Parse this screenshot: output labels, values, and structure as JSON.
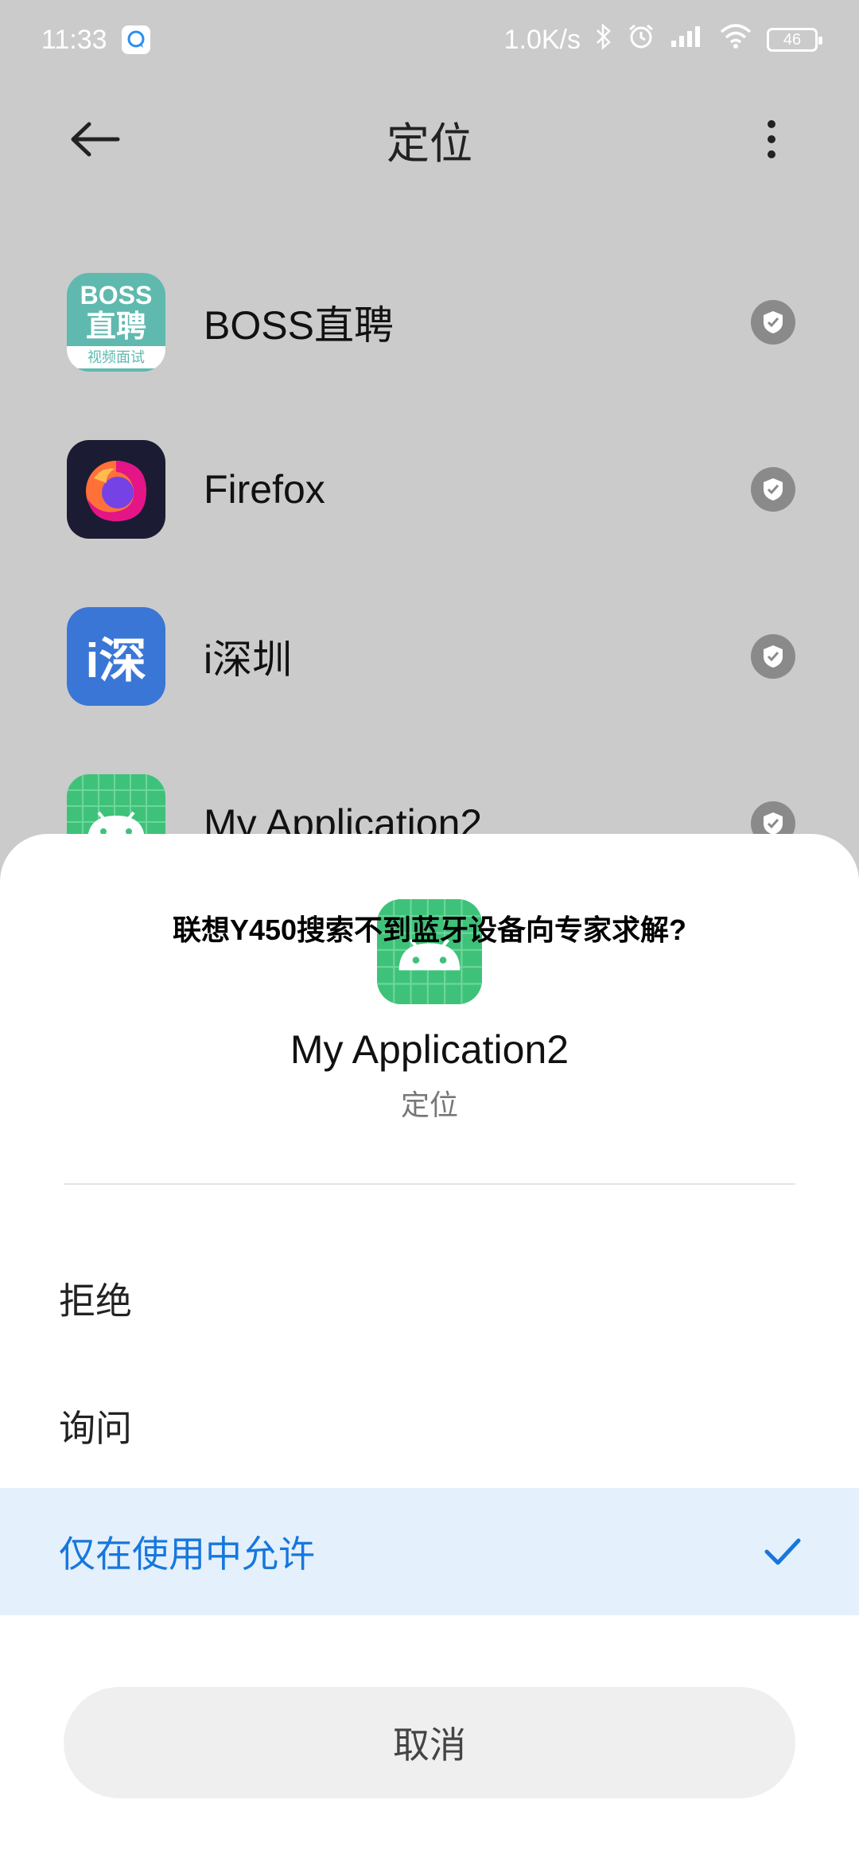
{
  "status_bar": {
    "time": "11:33",
    "network_speed": "1.0K/s",
    "battery": "46",
    "icons": [
      "chat-bubble-icon",
      "bluetooth-icon",
      "alarm-icon",
      "signal-icon",
      "wifi-icon",
      "battery-icon"
    ]
  },
  "header": {
    "title": "定位",
    "back_icon": "arrow-left-icon",
    "more_icon": "more-vertical-icon"
  },
  "apps": [
    {
      "name": "BOSS直聘",
      "icon": "boss-app-icon",
      "icon_text_top": "BOSS",
      "icon_text_mid": "直聘",
      "icon_text_bottom": "视频面试"
    },
    {
      "name": "Firefox",
      "icon": "firefox-app-icon"
    },
    {
      "name": "i深圳",
      "icon": "ishenzhen-app-icon",
      "icon_text": "i深"
    },
    {
      "name": "My Application2",
      "icon": "android-app-icon"
    }
  ],
  "overlay_text": "联想Y450搜索不到蓝牙设备向专家求解?",
  "sheet": {
    "app_name": "My Application2",
    "permission": "定位",
    "options": [
      {
        "label": "拒绝",
        "selected": false
      },
      {
        "label": "询问",
        "selected": false
      },
      {
        "label": "仅在使用中允许",
        "selected": true
      }
    ],
    "cancel_label": "取消"
  },
  "colors": {
    "accent": "#1677dd",
    "selected_bg": "#e4f0fc",
    "badge": "#8a8a8a",
    "scrim": "#cbcbcb"
  }
}
